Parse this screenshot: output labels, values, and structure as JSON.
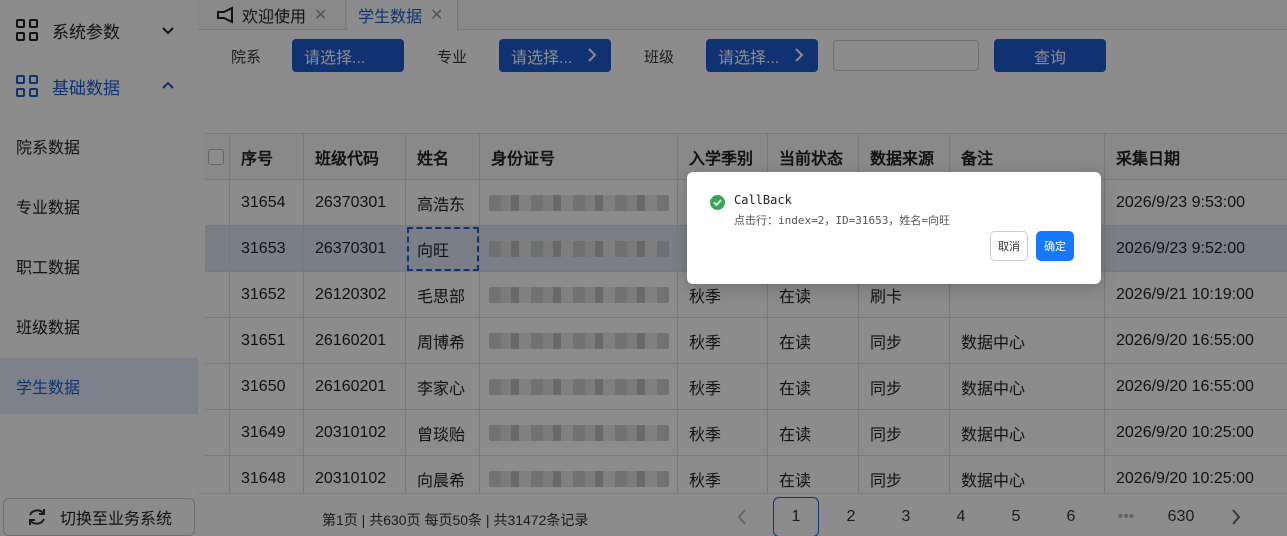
{
  "sidebar": {
    "group1_label": "系统参数",
    "group2_label": "基础数据",
    "items": [
      {
        "label": "院系数据"
      },
      {
        "label": "专业数据"
      },
      {
        "label": "职工数据"
      },
      {
        "label": "班级数据"
      },
      {
        "label": "学生数据"
      }
    ],
    "switch_label": "切换至业务系统"
  },
  "tabs": [
    {
      "label": "欢迎使用"
    },
    {
      "label": "学生数据"
    }
  ],
  "filters": {
    "dept_label": "院系",
    "dept_button": "请选择...",
    "major_label": "专业",
    "major_button": "请选择...",
    "class_label": "班级",
    "class_button": "请选择...",
    "search_value": "",
    "query_button": "查询"
  },
  "table": {
    "headers": [
      "序号",
      "班级代码",
      "姓名",
      "身份证号",
      "入学季别",
      "当前状态",
      "数据来源",
      "备注",
      "采集日期"
    ],
    "rows": [
      [
        "31654",
        "26370301",
        "高浩东",
        "",
        "",
        "",
        "",
        "",
        "2026/9/23 9:53:00"
      ],
      [
        "31653",
        "26370301",
        "向旺",
        "",
        "",
        "",
        "",
        "",
        "2026/9/23 9:52:00"
      ],
      [
        "31652",
        "26120302",
        "毛思部",
        "",
        "秋季",
        "在读",
        "刷卡",
        "",
        "2026/9/21 10:19:00"
      ],
      [
        "31651",
        "26160201",
        "周博希",
        "",
        "秋季",
        "在读",
        "同步",
        "数据中心",
        "2026/9/20 16:55:00"
      ],
      [
        "31650",
        "26160201",
        "李家心",
        "",
        "秋季",
        "在读",
        "同步",
        "数据中心",
        "2026/9/20 16:55:00"
      ],
      [
        "31649",
        "20310102",
        "曾琰贻",
        "",
        "秋季",
        "在读",
        "同步",
        "数据中心",
        "2026/9/20 10:25:00"
      ],
      [
        "31648",
        "20310102",
        "向晨希",
        "",
        "秋季",
        "在读",
        "同步",
        "数据中心",
        "2026/9/20 10:25:00"
      ]
    ]
  },
  "pagination": {
    "info": "第1页 | 共630页 每页50条 | 共31472条记录",
    "pages": [
      "1",
      "2",
      "3",
      "4",
      "5",
      "6",
      "•••",
      "630"
    ],
    "current": "1"
  },
  "dialog": {
    "title": "CallBack",
    "message": "点击行：index=2，ID=31653，姓名=向旺",
    "cancel": "取消",
    "ok": "确定"
  },
  "colors": {
    "accent": "#1e5ccf",
    "dialog_ok": "#1677ff",
    "success": "#34a853"
  }
}
